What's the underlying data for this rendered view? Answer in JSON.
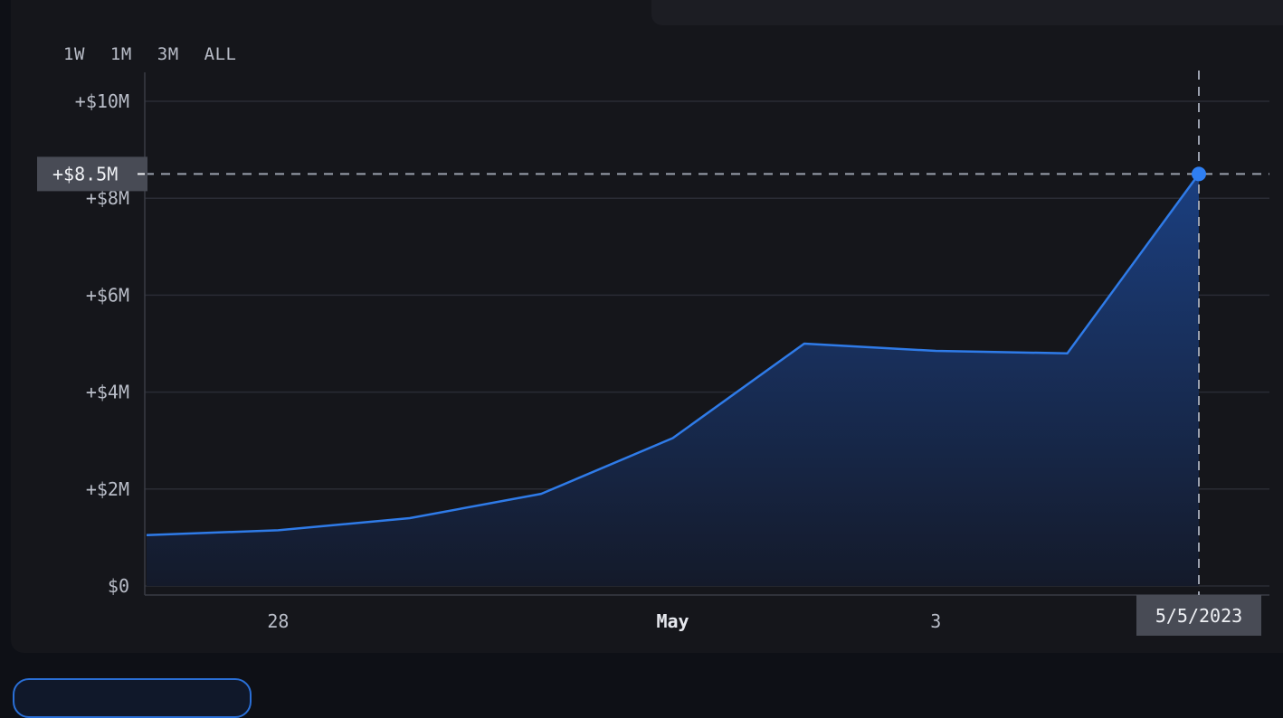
{
  "range_tabs": [
    "1W",
    "1M",
    "3M",
    "ALL"
  ],
  "colors": {
    "line": "#2f7be8",
    "fill_top": "#1b3f80",
    "grid": "#2a2c35",
    "axis_text": "#b9bdc8",
    "crosshair": "#9aa0ad",
    "tag_bg": "#484b55",
    "tag_text": "#eef0f4",
    "marker": "#2f7ff2"
  },
  "chart_data": {
    "type": "area",
    "title": "",
    "xlabel": "",
    "ylabel": "",
    "x": [
      "2023-04-27",
      "2023-04-28",
      "2023-04-29",
      "2023-04-30",
      "2023-05-01",
      "2023-05-02",
      "2023-05-03",
      "2023-05-04",
      "2023-05-05"
    ],
    "values": [
      1.05,
      1.15,
      1.4,
      1.9,
      3.05,
      5.0,
      4.85,
      4.8,
      8.5
    ],
    "ylim": [
      0,
      10
    ],
    "y_ticks": [
      {
        "value": 0,
        "label": "$0"
      },
      {
        "value": 2,
        "label": "+$2M"
      },
      {
        "value": 4,
        "label": "+$4M"
      },
      {
        "value": 6,
        "label": "+$6M"
      },
      {
        "value": 8,
        "label": "+$8M"
      },
      {
        "value": 10,
        "label": "+$10M"
      }
    ],
    "x_ticks": [
      {
        "x": "2023-04-28",
        "label": "28",
        "bold": false
      },
      {
        "x": "2023-05-01",
        "label": "May",
        "bold": true
      },
      {
        "x": "2023-05-03",
        "label": "3",
        "bold": false
      }
    ],
    "grid": true,
    "crosshair": {
      "x": "2023-05-05",
      "value": 8.5,
      "y_label": "+$8.5M",
      "x_label": "5/5/2023"
    }
  }
}
